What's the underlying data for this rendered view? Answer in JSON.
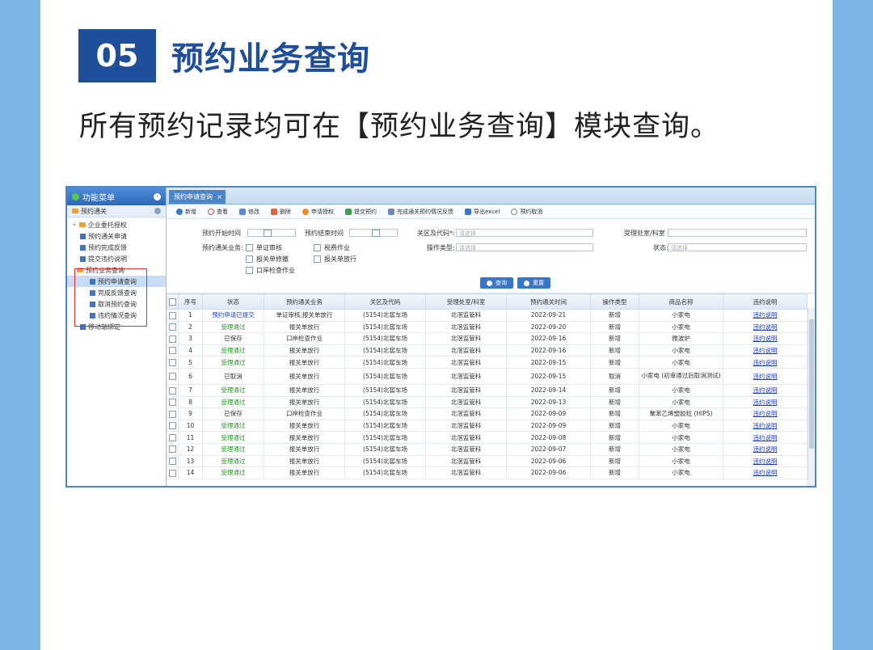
{
  "section": {
    "number": "05",
    "title": "预约业务查询"
  },
  "description": "所有预约记录均可在【预约业务查询】模块查询。",
  "app": {
    "sidebar": {
      "header": "功能菜单",
      "group": "预约通关",
      "items": [
        "企业委托授权",
        "预约通关申请",
        "预约完成反馈",
        "提交违约说明",
        "预约业务查询",
        "预约申请查询",
        "完成反馈查询",
        "取消预约查询",
        "违约情况查询",
        "移动端绑定"
      ]
    },
    "tab": "预约申请查询",
    "toolbar": [
      "新增",
      "查看",
      "修改",
      "删除",
      "申请授权",
      "提交预约",
      "完成通关预约情况反馈",
      "导出excel",
      "预约取消"
    ],
    "form": {
      "start_time_label": "预约开始时间",
      "end_time_label": "预约结束时间",
      "area_label": "关区及代码*:",
      "area_placeholder": "请选择",
      "dept_label": "受理处室/科室",
      "business_label": "预约通关业务:",
      "op_type_label": "操作类型:",
      "op_type_placeholder": "请选择",
      "status_label": "状态:",
      "status_placeholder": "请选择",
      "checkboxes": [
        "单证审核",
        "税费作业",
        "报关单修撤",
        "报关单放行",
        "口岸检查作业"
      ],
      "query_button": "查询",
      "reset_button": "重置"
    },
    "table": {
      "columns": [
        "序号",
        "状态",
        "预约通关业务",
        "关区及代码",
        "受理处室/科室",
        "预约通关时间",
        "操作类型",
        "商品名称",
        "违约说明"
      ],
      "rows": [
        [
          "1",
          "预约申请已提交",
          "单证审核,报关单放行",
          "(5154)北窖车场",
          "北滘监管科",
          "2022-09-21",
          "新增",
          "小家电",
          "违约说明"
        ],
        [
          "2",
          "受理通过",
          "报关单放行",
          "(5154)北窖车场",
          "北滘监管科",
          "2022-09-20",
          "新增",
          "小家电",
          "违约说明"
        ],
        [
          "3",
          "已保存",
          "口岸检查作业",
          "(5154)北窖车场",
          "北滘监管科",
          "2022-09-16",
          "新增",
          "微波炉",
          "违约说明"
        ],
        [
          "4",
          "受理通过",
          "报关单放行",
          "(5154)北窖车场",
          "北滘监管科",
          "2022-09-16",
          "新增",
          "小家电",
          "违约说明"
        ],
        [
          "5",
          "受理通过",
          "报关单放行",
          "(5154)北窖车场",
          "北滘监管科",
          "2022-09-15",
          "新增",
          "小家电",
          "违约说明"
        ],
        [
          "6",
          "已取消",
          "报关单放行",
          "(5154)北窖车场",
          "北滘监管科",
          "2022-09-15",
          "取消",
          "小家电 (初审通过后取消测试)",
          "违约说明"
        ],
        [
          "7",
          "受理通过",
          "报关单放行",
          "(5154)北窖车场",
          "北滘监管科",
          "2022-09-14",
          "新增",
          "小家电",
          "违约说明"
        ],
        [
          "8",
          "受理通过",
          "报关单放行",
          "(5154)北窖车场",
          "北滘监管科",
          "2022-09-13",
          "新增",
          "小家电",
          "违约说明"
        ],
        [
          "9",
          "已保存",
          "口岸检查作业",
          "(5154)北窖车场",
          "北滘监管科",
          "2022-09-09",
          "新增",
          "聚苯乙烯塑胶粒 (HIPS)",
          "违约说明"
        ],
        [
          "10",
          "受理通过",
          "报关单放行",
          "(5154)北窖车场",
          "北滘监管科",
          "2022-09-09",
          "新增",
          "小家电",
          "违约说明"
        ],
        [
          "11",
          "受理通过",
          "报关单放行",
          "(5154)北窖车场",
          "北滘监管科",
          "2022-09-08",
          "新增",
          "小家电",
          "违约说明"
        ],
        [
          "12",
          "受理通过",
          "报关单放行",
          "(5154)北窖车场",
          "北滘监管科",
          "2022-09-07",
          "新增",
          "小家电",
          "违约说明"
        ],
        [
          "13",
          "受理通过",
          "报关单放行",
          "(5154)北窖车场",
          "北滘监管科",
          "2022-09-06",
          "新增",
          "小家电",
          "违约说明"
        ],
        [
          "14",
          "受理通过",
          "报关单放行",
          "(5154)北窖车场",
          "北滘监管科",
          "2022-09-06",
          "新增",
          "小家电",
          "违约说明"
        ]
      ]
    }
  },
  "colors": {
    "brand": "#1f4e9a",
    "page_bg": "#7db6e6",
    "status_ok": "#1a9c1a",
    "status_submitted": "#2040c0",
    "highlight_box": "#e03030"
  }
}
